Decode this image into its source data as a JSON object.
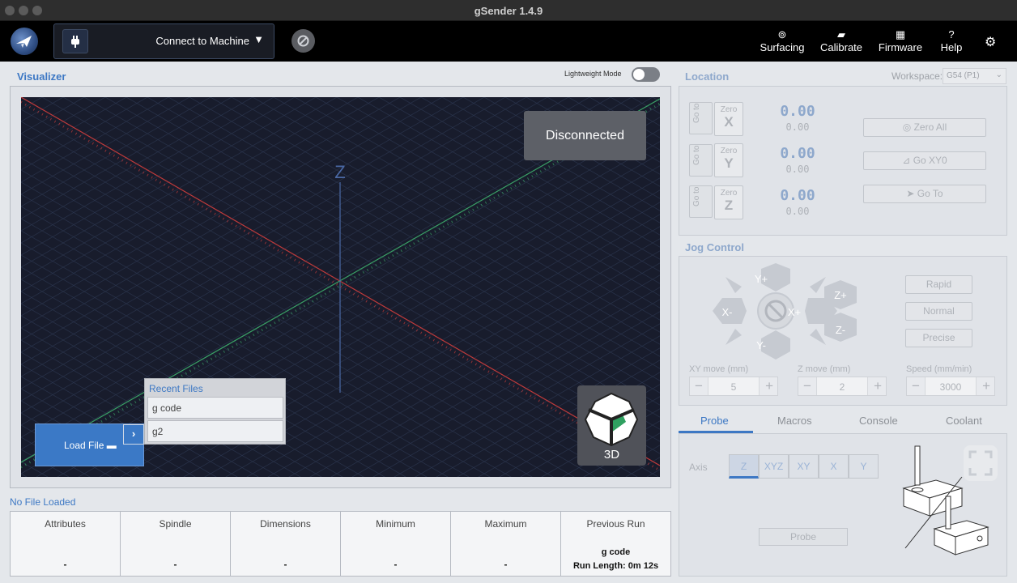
{
  "window": {
    "title": "gSender 1.4.9"
  },
  "nav": {
    "connect_label": "Connect to Machine",
    "items": [
      {
        "label": "Surfacing",
        "icon": "surfacing-icon"
      },
      {
        "label": "Calibrate",
        "icon": "ruler-icon"
      },
      {
        "label": "Firmware",
        "icon": "chip-icon"
      },
      {
        "label": "Help",
        "icon": "question-icon"
      }
    ]
  },
  "visualizer": {
    "title": "Visualizer",
    "lightweight_label": "Lightweight Mode",
    "lightweight_on": false,
    "status": "Disconnected",
    "axis_label": "Z",
    "view_label": "3D",
    "load_label": "Load File",
    "recent_title": "Recent Files",
    "recent_files": [
      "g code",
      "g2"
    ]
  },
  "file_info": {
    "title": "No File Loaded",
    "columns": [
      {
        "header": "Attributes",
        "value": "-"
      },
      {
        "header": "Spindle",
        "value": "-"
      },
      {
        "header": "Dimensions",
        "value": "-"
      },
      {
        "header": "Minimum",
        "value": "-"
      },
      {
        "header": "Maximum",
        "value": "-"
      },
      {
        "header": "Previous Run",
        "line1": "g code",
        "line2": "Run Length: 0m 12s"
      }
    ]
  },
  "location": {
    "title": "Location",
    "workspace_label": "Workspace:",
    "workspace_value": "G54 (P1)",
    "goto_label": "Go to",
    "zero_label": "Zero",
    "axes": [
      {
        "axis": "X",
        "work": "0.00",
        "machine": "0.00"
      },
      {
        "axis": "Y",
        "work": "0.00",
        "machine": "0.00"
      },
      {
        "axis": "Z",
        "work": "0.00",
        "machine": "0.00"
      }
    ],
    "actions": [
      "Zero All",
      "Go XY0",
      "Go  To"
    ]
  },
  "jog": {
    "title": "Jog Control",
    "labels": {
      "yplus": "Y+",
      "yminus": "Y-",
      "xplus": "X+",
      "xminus": "X-",
      "zplus": "Z+",
      "zminus": "Z-"
    },
    "speeds": [
      "Rapid",
      "Normal",
      "Precise"
    ],
    "xy_label": "XY move (mm)",
    "xy_value": "5",
    "z_label": "Z move (mm)",
    "z_value": "2",
    "speed_label": "Speed (mm/min)",
    "speed_value": "3000"
  },
  "tabs": [
    "Probe",
    "Macros",
    "Console",
    "Coolant"
  ],
  "probe": {
    "axis_label": "Axis",
    "axes": [
      "Z",
      "XYZ",
      "XY",
      "X",
      "Y"
    ],
    "button": "Probe"
  },
  "colors": {
    "accent": "#3d78c4",
    "canvas": "#181c2c",
    "x_axis": "#c03a3a",
    "y_axis": "#3aa066"
  }
}
